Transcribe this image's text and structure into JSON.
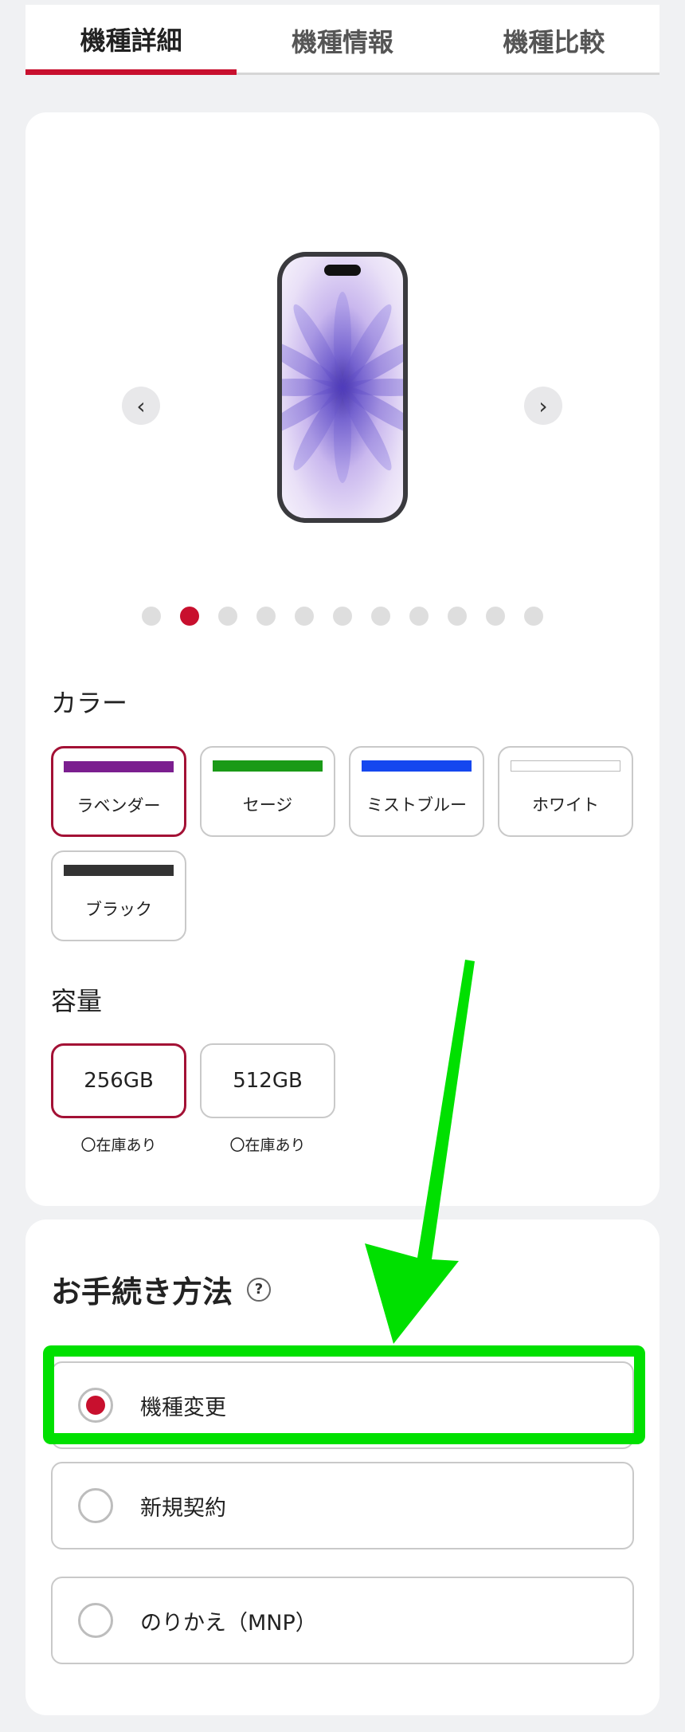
{
  "tabs": [
    {
      "label": "機種詳細",
      "active": true
    },
    {
      "label": "機種情報",
      "active": false
    },
    {
      "label": "機種比較",
      "active": false
    }
  ],
  "carousel": {
    "prev_icon": "chevron-left-icon",
    "next_icon": "chevron-right-icon",
    "prev_glyph": "‹",
    "next_glyph": "›",
    "page_count": 11,
    "active_index": 1
  },
  "color": {
    "title": "カラー",
    "options": [
      {
        "label": "ラベンダー",
        "swatch": "#7b1e8f",
        "selected": true
      },
      {
        "label": "セージ",
        "swatch": "#1a9a17",
        "selected": false
      },
      {
        "label": "ミストブルー",
        "swatch": "#1547ef",
        "selected": false
      },
      {
        "label": "ホワイト",
        "swatch": "#ffffff",
        "selected": false
      },
      {
        "label": "ブラック",
        "swatch": "#333333",
        "selected": false
      }
    ]
  },
  "capacity": {
    "title": "容量",
    "options": [
      {
        "label": "256GB",
        "stock": "〇在庫あり",
        "selected": true
      },
      {
        "label": "512GB",
        "stock": "〇在庫あり",
        "selected": false
      }
    ]
  },
  "procedure": {
    "title": "お手続き方法",
    "help_glyph": "?",
    "options": [
      {
        "label": "機種変更",
        "selected": true
      },
      {
        "label": "新規契約",
        "selected": false
      },
      {
        "label": "のりかえ（MNP）",
        "selected": false
      }
    ]
  },
  "colors": {
    "accent": "#c8102e",
    "highlight": "#00e000"
  }
}
